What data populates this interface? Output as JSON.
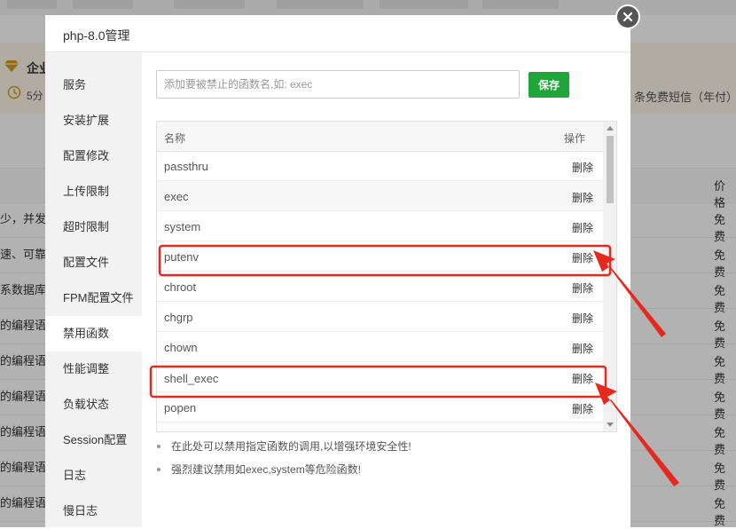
{
  "background": {
    "banner_title": "企业",
    "banner_sub": "5分",
    "banner_right": "条免费短信（年付）",
    "price_header": "价格",
    "rows": [
      {
        "left": "少，并发",
        "right": "免费"
      },
      {
        "left": "速、可靠",
        "right": "免费"
      },
      {
        "left": "系数据库管",
        "right": "免费"
      },
      {
        "left": "的编程语",
        "right": "免费"
      },
      {
        "left": "的编程语",
        "right": "免费"
      },
      {
        "left": "的编程语",
        "right": "免费"
      },
      {
        "left": "的编程语",
        "right": "免费"
      },
      {
        "left": "的编程语",
        "right": "免费"
      },
      {
        "left": "的编程语",
        "right": "免费"
      }
    ]
  },
  "modal": {
    "title": "php-8.0管理",
    "sidebar": [
      "服务",
      "安装扩展",
      "配置修改",
      "上传限制",
      "超时限制",
      "配置文件",
      "FPM配置文件",
      "禁用函数",
      "性能调整",
      "负载状态",
      "Session配置",
      "日志",
      "慢日志"
    ],
    "active_index": 7,
    "input_placeholder": "添加要被禁止的函数名,如: exec",
    "save_label": "保存",
    "table": {
      "col_name": "名称",
      "col_op": "操作",
      "delete_label": "删除",
      "rows": [
        "passthru",
        "exec",
        "system",
        "putenv",
        "chroot",
        "chgrp",
        "chown",
        "shell_exec",
        "popen"
      ]
    },
    "notes": [
      "在此处可以禁用指定函数的调用,以增强环境安全性!",
      "强烈建议禁用如exec,system等危险函数!"
    ]
  },
  "colors": {
    "accent": "#20a53a",
    "highlight": "#e5291e",
    "overlay": "rgba(0,0,0,0.3)"
  },
  "icons": [
    "gem-icon",
    "clock-icon",
    "close-icon",
    "scroll-up-icon",
    "scroll-down-icon"
  ]
}
